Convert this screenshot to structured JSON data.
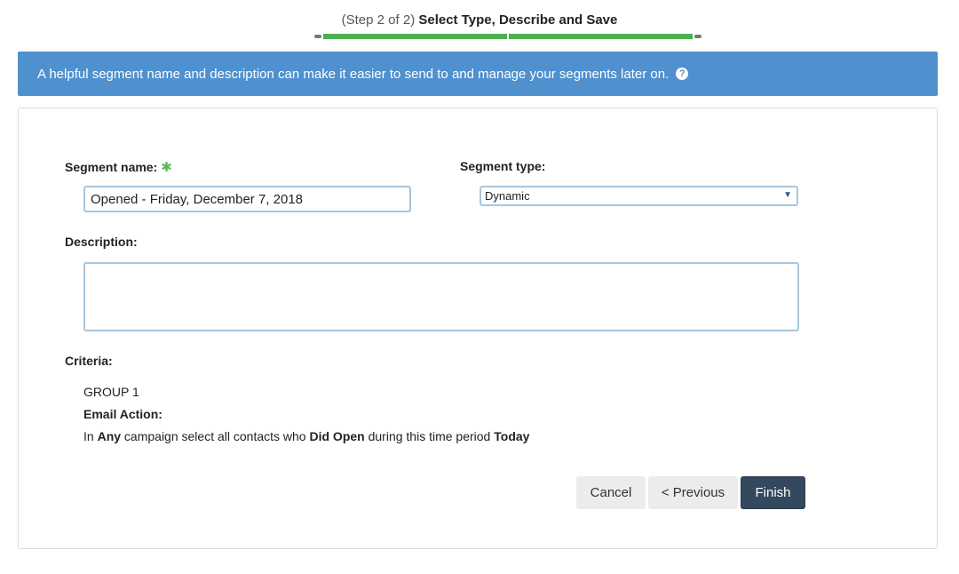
{
  "step": {
    "prefix": "(Step 2 of 2)",
    "title": "Select Type, Describe and Save"
  },
  "banner": {
    "text": "A helpful segment name and description can make it easier to send to and manage your segments later on.",
    "help_icon": "?"
  },
  "form": {
    "segment_name_label": "Segment name:",
    "required_mark": "✱",
    "segment_name_value": "Opened - Friday, December 7, 2018",
    "segment_type_label": "Segment type:",
    "segment_type_value": "Dynamic",
    "segment_type_caret": "▼",
    "description_label": "Description:",
    "description_value": ""
  },
  "criteria": {
    "label": "Criteria:",
    "group": "GROUP 1",
    "email_action_label": "Email Action:",
    "sentence": {
      "part1": "In",
      "campaign": "Any",
      "part2": "campaign select all contacts who",
      "action": "Did Open",
      "part3": "during this time period",
      "period": "Today"
    }
  },
  "buttons": {
    "cancel": "Cancel",
    "previous": "< Previous",
    "finish": "Finish"
  },
  "colors": {
    "banner_bg": "#4f90ce",
    "progress": "#4caf50",
    "primary_button": "#34495e",
    "required": "#5cb85c"
  }
}
